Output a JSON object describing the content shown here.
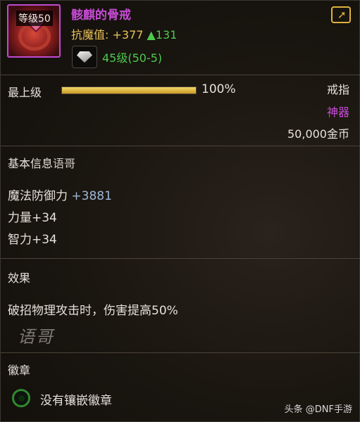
{
  "item": {
    "level_badge": "等级50",
    "name": "骸麒的骨戒",
    "stat_key": "抗魔值:",
    "stat_value": "+377",
    "stat_bonus": "▲131",
    "socket_text": "45级(50-5)",
    "icon": "crimson-ring-icon",
    "name_color": "#c74bd6"
  },
  "upgrade": {
    "label": "最上级",
    "percent_text": "100%",
    "progress": 1.0
  },
  "meta": {
    "slot": "戒指",
    "grade": "神器",
    "price": "50,000金币"
  },
  "basic": {
    "title": "基本信息",
    "watermark": "语哥",
    "lines": [
      {
        "label": "魔法防御力",
        "value": "+3881"
      },
      {
        "label": "力量+34"
      },
      {
        "label": "智力+34"
      }
    ]
  },
  "effect": {
    "title": "效果",
    "desc": "破招物理攻击时，伤害提高50%",
    "signature": "语哥"
  },
  "emblem": {
    "title": "徽章",
    "text": "没有镶嵌徽章"
  },
  "footer": {
    "watermark": "头条 @DNF手游"
  }
}
